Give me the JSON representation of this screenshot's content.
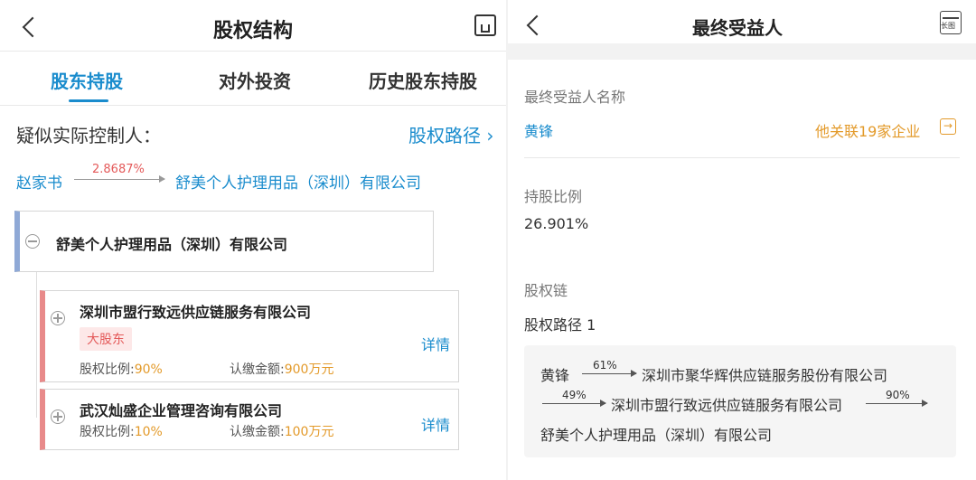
{
  "left": {
    "header": {
      "title": "股权结构",
      "back_icon": "back-arrow-icon",
      "save_icon": "floppy-disk-icon"
    },
    "tabs": [
      {
        "label": "股东持股",
        "active": true
      },
      {
        "label": "对外投资",
        "active": false
      },
      {
        "label": "历史股东持股",
        "active": false
      }
    ],
    "controller": {
      "heading": "疑似实际控制人：",
      "path_link": "股权路径",
      "person": "赵家书",
      "percent": "2.8687%",
      "company": "舒美个人护理用品（深圳）有限公司"
    },
    "root": {
      "name": "舒美个人护理用品（深圳）有限公司"
    },
    "shareholders": [
      {
        "name": "深圳市盟行致远供应链服务有限公司",
        "badge": "大股东",
        "ratio_label": "股权比例:",
        "ratio": "90%",
        "amount_label": "认缴金额:",
        "amount": "900万元",
        "detail": "详情"
      },
      {
        "name": "武汉灿盛企业管理咨询有限公司",
        "badge": "",
        "ratio_label": "股权比例:",
        "ratio": "10%",
        "amount_label": "认缴金额:",
        "amount": "100万元",
        "detail": "详情"
      }
    ]
  },
  "right": {
    "header": {
      "title": "最终受益人",
      "long_image_label": "长图"
    },
    "beneficiary": {
      "name_label": "最终受益人名称",
      "name": "黄锋",
      "related": "他关联19家企业"
    },
    "holding": {
      "label": "持股比例",
      "value": "26.901%"
    },
    "chain": {
      "label": "股权链",
      "path_title": "股权路径 1",
      "start": "黄锋",
      "p1": "61%",
      "c1": "深圳市聚华辉供应链服务股份有限公司",
      "p2": "49%",
      "c2": "深圳市盟行致远供应链服务有限公司",
      "p3": "90%",
      "c3": "舒美个人护理用品（深圳）有限公司"
    }
  },
  "colors": {
    "accent": "#1a8ccd",
    "orange": "#e39a2a",
    "red": "#e45a5a"
  }
}
